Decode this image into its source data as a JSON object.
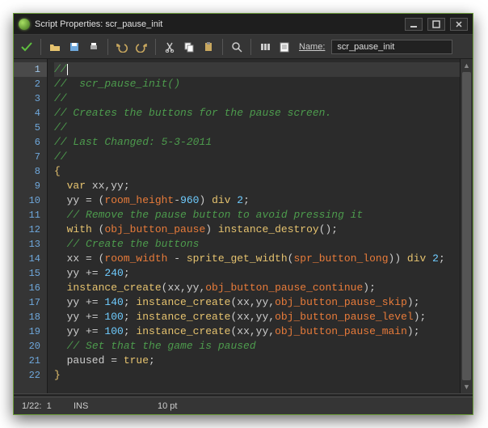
{
  "window": {
    "title": "Script Properties: scr_pause_init"
  },
  "toolbar": {
    "name_label": "Name:",
    "name_value": "scr_pause_init"
  },
  "code": {
    "lines": [
      [
        {
          "t": "comment",
          "v": "//"
        }
      ],
      [
        {
          "t": "comment",
          "v": "//  scr_pause_init()"
        }
      ],
      [
        {
          "t": "comment",
          "v": "//"
        }
      ],
      [
        {
          "t": "comment",
          "v": "// Creates the buttons for the pause screen."
        }
      ],
      [
        {
          "t": "comment",
          "v": "//"
        }
      ],
      [
        {
          "t": "comment",
          "v": "// Last Changed: 5-3-2011"
        }
      ],
      [
        {
          "t": "comment",
          "v": "//"
        }
      ],
      [
        {
          "t": "brace",
          "v": "{"
        }
      ],
      [
        {
          "t": "plain",
          "v": "  "
        },
        {
          "t": "key",
          "v": "var"
        },
        {
          "t": "plain",
          "v": " xx,yy;"
        }
      ],
      [
        {
          "t": "plain",
          "v": "  yy = ("
        },
        {
          "t": "ident",
          "v": "room_height"
        },
        {
          "t": "plain",
          "v": "-"
        },
        {
          "t": "num",
          "v": "960"
        },
        {
          "t": "plain",
          "v": ") "
        },
        {
          "t": "key",
          "v": "div"
        },
        {
          "t": "plain",
          "v": " "
        },
        {
          "t": "num",
          "v": "2"
        },
        {
          "t": "plain",
          "v": ";"
        }
      ],
      [
        {
          "t": "plain",
          "v": "  "
        },
        {
          "t": "comment",
          "v": "// Remove the pause button to avoid pressing it"
        }
      ],
      [
        {
          "t": "plain",
          "v": "  "
        },
        {
          "t": "key",
          "v": "with"
        },
        {
          "t": "plain",
          "v": " ("
        },
        {
          "t": "ident",
          "v": "obj_button_pause"
        },
        {
          "t": "plain",
          "v": ") "
        },
        {
          "t": "func",
          "v": "instance_destroy"
        },
        {
          "t": "plain",
          "v": "();"
        }
      ],
      [
        {
          "t": "plain",
          "v": "  "
        },
        {
          "t": "comment",
          "v": "// Create the buttons"
        }
      ],
      [
        {
          "t": "plain",
          "v": "  xx = ("
        },
        {
          "t": "ident",
          "v": "room_width"
        },
        {
          "t": "plain",
          "v": " - "
        },
        {
          "t": "func",
          "v": "sprite_get_width"
        },
        {
          "t": "plain",
          "v": "("
        },
        {
          "t": "ident",
          "v": "spr_button_long"
        },
        {
          "t": "plain",
          "v": ")) "
        },
        {
          "t": "key",
          "v": "div"
        },
        {
          "t": "plain",
          "v": " "
        },
        {
          "t": "num",
          "v": "2"
        },
        {
          "t": "plain",
          "v": ";"
        }
      ],
      [
        {
          "t": "plain",
          "v": "  yy += "
        },
        {
          "t": "num",
          "v": "240"
        },
        {
          "t": "plain",
          "v": ";"
        }
      ],
      [
        {
          "t": "plain",
          "v": "  "
        },
        {
          "t": "func",
          "v": "instance_create"
        },
        {
          "t": "plain",
          "v": "(xx,yy,"
        },
        {
          "t": "ident",
          "v": "obj_button_pause_continue"
        },
        {
          "t": "plain",
          "v": ");"
        }
      ],
      [
        {
          "t": "plain",
          "v": "  yy += "
        },
        {
          "t": "num",
          "v": "140"
        },
        {
          "t": "plain",
          "v": "; "
        },
        {
          "t": "func",
          "v": "instance_create"
        },
        {
          "t": "plain",
          "v": "(xx,yy,"
        },
        {
          "t": "ident",
          "v": "obj_button_pause_skip"
        },
        {
          "t": "plain",
          "v": ");"
        }
      ],
      [
        {
          "t": "plain",
          "v": "  yy += "
        },
        {
          "t": "num",
          "v": "100"
        },
        {
          "t": "plain",
          "v": "; "
        },
        {
          "t": "func",
          "v": "instance_create"
        },
        {
          "t": "plain",
          "v": "(xx,yy,"
        },
        {
          "t": "ident",
          "v": "obj_button_pause_level"
        },
        {
          "t": "plain",
          "v": ");"
        }
      ],
      [
        {
          "t": "plain",
          "v": "  yy += "
        },
        {
          "t": "num",
          "v": "100"
        },
        {
          "t": "plain",
          "v": "; "
        },
        {
          "t": "func",
          "v": "instance_create"
        },
        {
          "t": "plain",
          "v": "(xx,yy,"
        },
        {
          "t": "ident",
          "v": "obj_button_pause_main"
        },
        {
          "t": "plain",
          "v": ");"
        }
      ],
      [
        {
          "t": "plain",
          "v": "  "
        },
        {
          "t": "comment",
          "v": "// Set that the game is paused"
        }
      ],
      [
        {
          "t": "plain",
          "v": "  paused = "
        },
        {
          "t": "key",
          "v": "true"
        },
        {
          "t": "plain",
          "v": ";"
        }
      ],
      [
        {
          "t": "brace",
          "v": "}"
        }
      ]
    ],
    "current_line": 1
  },
  "status": {
    "position": "1/22:",
    "column": "1",
    "mode": "INS",
    "fontsize": "10 pt"
  },
  "icons": {
    "check": "check-icon",
    "open": "open-icon",
    "save": "save-icon",
    "print": "print-icon",
    "undo": "undo-icon",
    "redo": "redo-icon",
    "cut": "cut-icon",
    "copy": "copy-icon",
    "paste": "paste-icon",
    "find": "find-icon",
    "replace": "replace-icon",
    "goto": "goto-icon",
    "info": "info-icon"
  }
}
